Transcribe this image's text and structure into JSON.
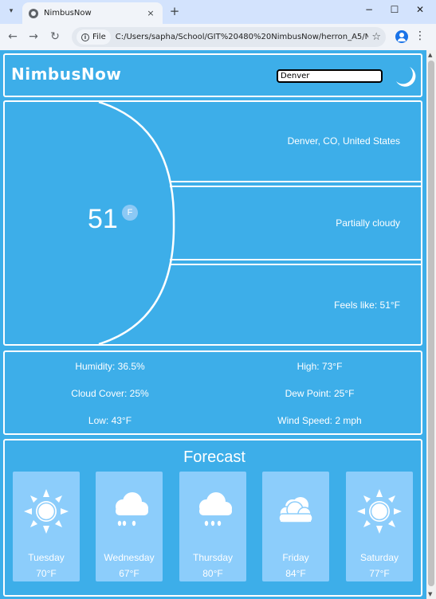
{
  "browser": {
    "tab_title": "NimbusNow",
    "tab_close": "×",
    "new_tab": "+",
    "site_label": "File",
    "url": "C:/Users/sapha/School/GIT%20480%20NimbusNow/herron_A5/Ni...",
    "back": "←",
    "forward": "→",
    "reload": "↻",
    "star": "☆",
    "minimize": "−",
    "maximize": "☐",
    "close": "✕",
    "menu": "⋮",
    "tab_menu": "▾"
  },
  "header": {
    "brand": "NimbusNow",
    "search_value": "Denver",
    "theme_icon": "moon-icon"
  },
  "current": {
    "temperature": "51",
    "unit": "F",
    "location": "Denver, CO, United States",
    "condition": "Partially cloudy",
    "feels_like": "Feels like: 51°F"
  },
  "details": {
    "humidity": "Humidity: 36.5%",
    "high": "High: 73°F",
    "cloud_cover": "Cloud Cover: 25%",
    "dew_point": "Dew Point: 25°F",
    "low": "Low: 43°F",
    "wind_speed": "Wind Speed: 2 mph"
  },
  "forecast": {
    "title": "Forecast",
    "days": [
      {
        "day": "Tuesday",
        "temp": "70°F",
        "icon": "sun-icon"
      },
      {
        "day": "Wednesday",
        "temp": "67°F",
        "icon": "rain-cloud-icon"
      },
      {
        "day": "Thursday",
        "temp": "80°F",
        "icon": "rain-cloud-icon"
      },
      {
        "day": "Friday",
        "temp": "84°F",
        "icon": "cloud-icon"
      },
      {
        "day": "Saturday",
        "temp": "77°F",
        "icon": "sun-icon"
      }
    ]
  },
  "colors": {
    "page_bg": "#3daee9",
    "card_bg": "#8ccdfb",
    "border": "#ffffff",
    "text": "#ffffff"
  }
}
